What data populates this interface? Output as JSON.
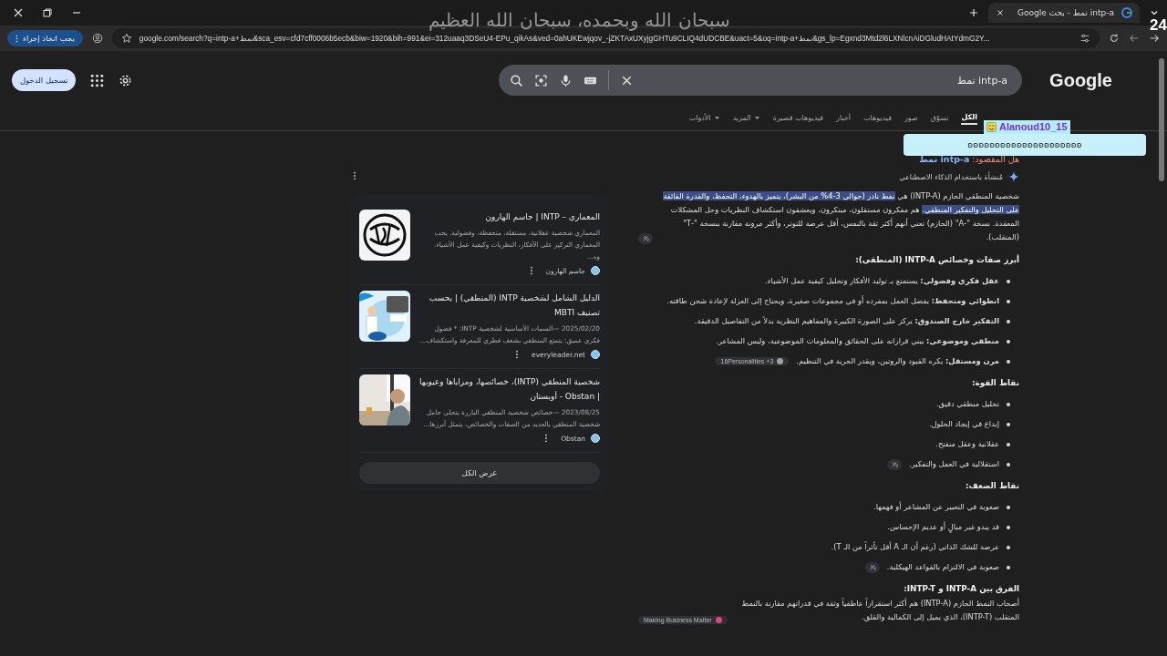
{
  "browser": {
    "tabs": [
      {
        "title": "intp-a نمط - بحث Google",
        "selected": true
      }
    ],
    "url": "google.com/search?q=intp-a+نمط&sca_esv=cfd7cff0006b5ecb&biw=1920&bih=991&ei=312uaaq3DSeU4-EPu_qikAs&ved=0ahUKEwjqov_-jZKTAxUXyjgGHTu9CLIQ4dUDCBE&uact=5&oq=intp-a+نمط&gs_lp=Egxnd3Mtd2l6LXNlcnAiDGludHAtYdmG2Y...",
    "action_button": "يجب اتخاذ إجراء"
  },
  "overlay": {
    "caption": "سبحان الله وبحمده، سبحان الله العظيم",
    "corner_text": "24",
    "chat": {
      "user": "Alanoud10_15",
      "message": "ʚʚʚʚʚʚʚʚʚʚʚʚʚʚʚʚʚʚʚʚʚ"
    }
  },
  "header": {
    "logo": "Google",
    "query": "intp-a نمط",
    "sign_in": "تسجيل الدخول"
  },
  "search_tabs": [
    {
      "label": "الكل",
      "selected": true,
      "dropdown": false
    },
    {
      "label": "تسوّق",
      "selected": false,
      "dropdown": false
    },
    {
      "label": "صور",
      "selected": false,
      "dropdown": false
    },
    {
      "label": "فيديوهات",
      "selected": false,
      "dropdown": false
    },
    {
      "label": "أخبار",
      "selected": false,
      "dropdown": false
    },
    {
      "label": "فيديوهات قصيرة",
      "selected": false,
      "dropdown": false
    },
    {
      "label": "المزيد",
      "selected": false,
      "dropdown": true
    },
    {
      "label": "الأدوات",
      "selected": false,
      "dropdown": true
    }
  ],
  "did_you_mean": {
    "label": "هل المقصود:",
    "suggestion": "intp-a نمط"
  },
  "ai_overview": {
    "label": "مُنشأة باستخدام الذكاء الاصطناعي",
    "summary": [
      {
        "text": "شخصية المنطقي الحازم (INTP-A) هي ",
        "highlighted": false
      },
      {
        "text": "نمط نادر (حوالي 3-4% من البشر)، يتميز بالهدوء، التحفظ، والقدرة الفائقة على التحليل والتفكير المنطقي.",
        "highlighted": true
      },
      {
        "text": " هم مفكرون مستقلون، مبتكرون، ويعشقون استكشاف النظريات وحل المشكلات المعقدة. نسخة \"-A\" (الحازم) تعني أنهم أكثر ثقة بالنفس، أقل عرضة للتوتر، وأكثر مرونة مقارنة بنسخة \"-T\" (المتقلب).",
        "highlighted": false
      }
    ],
    "summary_link": true,
    "sections": [
      {
        "kind": "list",
        "heading": "أبرز صفات وخصائص INTP-A (المنطقي):",
        "items": [
          {
            "text": "**عقل فكري وفضولي:** يستمتع بـ توليد الأفكار وتحليل كيفية عمل الأشياء.",
            "link": false
          },
          {
            "text": "**انطوائي ومتحفظ:** يفضل العمل بمفرده أو في مجموعات صغيرة، ويحتاج إلى العزلة لإعادة شحن طاقته.",
            "link": false
          },
          {
            "text": "**التفكير خارج الصندوق:** يركز على الصورة الكبيرة والمفاهيم النظرية بدلاً من التفاصيل الدقيقة.",
            "link": false
          },
          {
            "text": "**منطقي وموضوعي:** يبني قراراته على الحقائق والمعلومات الموضوعية، وليس المشاعر.",
            "link": false
          },
          {
            "text": "**مرن ومستقل:** يكره القيود والروتين، ويقدر الحرية في التنظيم.",
            "source": "16Personalities +3",
            "link": false
          }
        ]
      },
      {
        "kind": "list",
        "heading": "نقاط القوة:",
        "items": [
          {
            "text": "تحليل منطقي دقيق.",
            "link": false
          },
          {
            "text": "إبداع في إيجاد الحلول.",
            "link": false
          },
          {
            "text": "عقلانية وعقل منفتح.",
            "link": false
          },
          {
            "text": "استقلالية في العمل والتفكير.",
            "link": true
          }
        ]
      },
      {
        "kind": "list",
        "heading": "نقاط الضعف:",
        "items": [
          {
            "text": "صعوبة في التعبير عن المشاعر أو فهمها.",
            "link": false
          },
          {
            "text": "قد يبدو غير مبالٍ أو عديم الإحساس.",
            "link": false
          },
          {
            "text": "عرضة للشك الذاتي (رغم أن الـ A أقل تأثراً من الـ T).",
            "link": false
          },
          {
            "text": "صعوبة في الالتزام بالقواعد الهيكلية.",
            "link": true
          }
        ]
      },
      {
        "kind": "paragraph",
        "heading": "الفرق بين INTP-A و INTP-T:",
        "text": "أصحاب النمط الحازم (INTP-A) هم أكثر استقراراً عاطفياً وثقة في قدراتهم مقارنة بالنمط المتقلب (INTP-T)، الذي يميل إلى الكمالية والقلق.",
        "source": "Making Business Matter"
      }
    ]
  },
  "sources": {
    "items": [
      {
        "title": "المعماري – INTP | جاسم الهارون",
        "snippet": "المعماري شخصية عقلانية، مستقلة، متحفظة، وفضولية. يحب المعماري التركيز على الأفكار، النظريات وكيفية عمل الأشياء. وه...",
        "site": "جاسم الهارون"
      },
      {
        "title": "الدليل الشامل لشخصية INTP (المنطقي) | بحسب تصنيف MBTI",
        "date": "2025/02/20 —",
        "snippet": "السمات الأساسية لشخصية INTP: * فضول فكري عميق: يتمتع المنطقي بشغف فطري للمعرفة واستكشاف...",
        "site": "everyleader.net"
      },
      {
        "title": "شخصية المنطقي (INTP)، خصائصها، ومزاياها وعيوبها | Obstan - أوبستان",
        "date": "2023/08/25 —",
        "snippet": "خصائص شخصية المنطقي البارزة يتحلى حامل شخصية المنطقي بالعديد من الصفات والخصائص، يتمثل أبرزها...",
        "site": "Obstan"
      }
    ],
    "show_all": "عرض الكل"
  }
}
